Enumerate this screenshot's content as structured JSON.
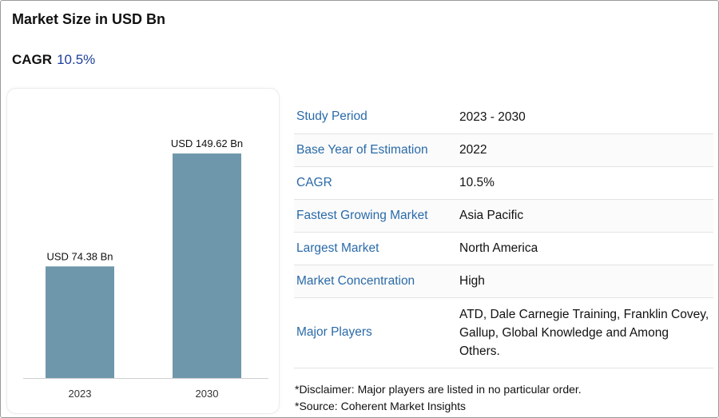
{
  "header": {
    "title": "Market Size in USD Bn",
    "cagr_label": "CAGR",
    "cagr_value": "10.5%"
  },
  "chart_data": {
    "type": "bar",
    "categories": [
      "2023",
      "2030"
    ],
    "values": [
      74.38,
      149.62
    ],
    "data_labels": [
      "USD 74.38 Bn",
      "USD 149.62 Bn"
    ],
    "title": "",
    "xlabel": "",
    "ylabel": "",
    "ylim": [
      0,
      180
    ],
    "grid": false,
    "bar_color": "#6f97ab"
  },
  "table": {
    "rows": [
      {
        "label": "Study Period",
        "value": "2023 - 2030"
      },
      {
        "label": "Base Year of Estimation",
        "value": "2022"
      },
      {
        "label": "CAGR",
        "value": "10.5%"
      },
      {
        "label": "Fastest Growing Market",
        "value": "Asia Pacific"
      },
      {
        "label": "Largest Market",
        "value": "North America"
      },
      {
        "label": "Market Concentration",
        "value": "High"
      },
      {
        "label": "Major Players",
        "value": "ATD, Dale Carnegie Training, Franklin Covey, Gallup, Global Knowledge and Among Others."
      }
    ]
  },
  "notes": {
    "disclaimer": "*Disclaimer: Major players are listed in no particular order.",
    "source": "*Source: Coherent Market Insights"
  },
  "colors": {
    "accent": "#1f3f9a",
    "label": "#2a6aa8",
    "bar": "#6f97ab"
  }
}
